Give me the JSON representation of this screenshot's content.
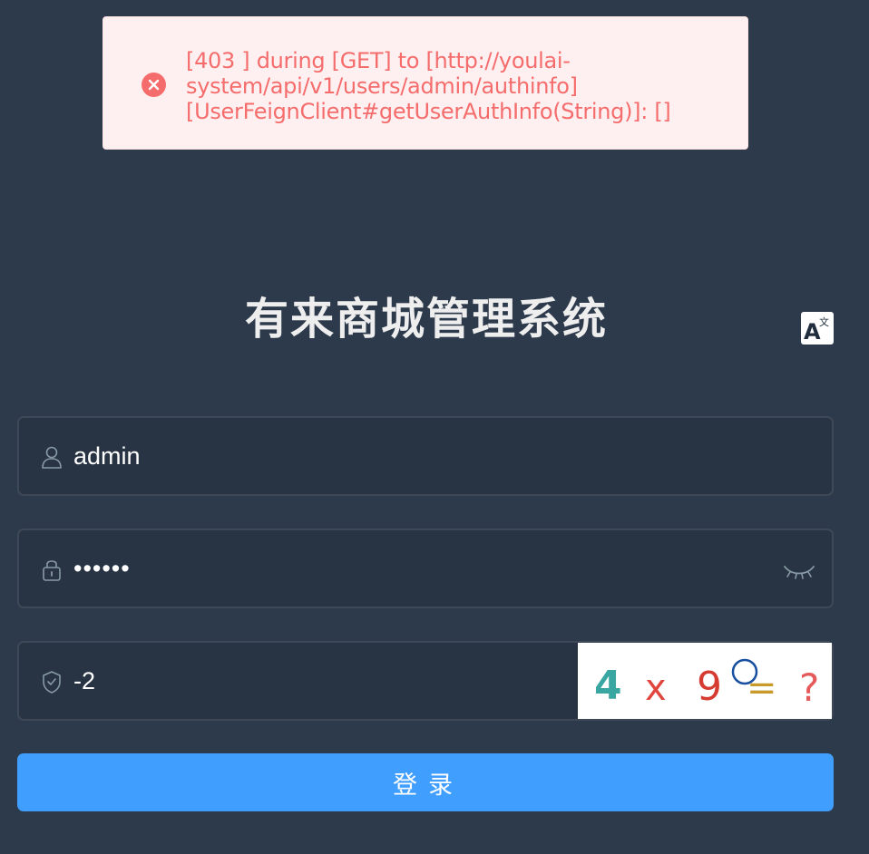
{
  "toast": {
    "type": "error",
    "icon": "close-circle-icon",
    "message": "[403 ] during [GET] to [http://youlai-\nsystem/api/v1/users/admin/authinfo]\n[UserFeignClient#getUserAuthInfo(String)]: []"
  },
  "title": "有来商城管理系统",
  "lang_switch": {
    "icon": "translate-icon",
    "glyph_a": "A",
    "glyph_wen": "文"
  },
  "username": {
    "icon": "user-icon",
    "value": "admin"
  },
  "password": {
    "icon": "lock-icon",
    "value": "••••••",
    "toggle_icon": "eye-closed-icon"
  },
  "captcha": {
    "icon": "shield-check-icon",
    "value": "-2",
    "image_text": [
      "4",
      "x",
      "9",
      "=",
      "?"
    ]
  },
  "login_button": "登录",
  "colors": {
    "background": "#2d3a4b",
    "error_text": "#f56c6c",
    "error_bg": "#fef0f0",
    "primary": "#409eff"
  }
}
